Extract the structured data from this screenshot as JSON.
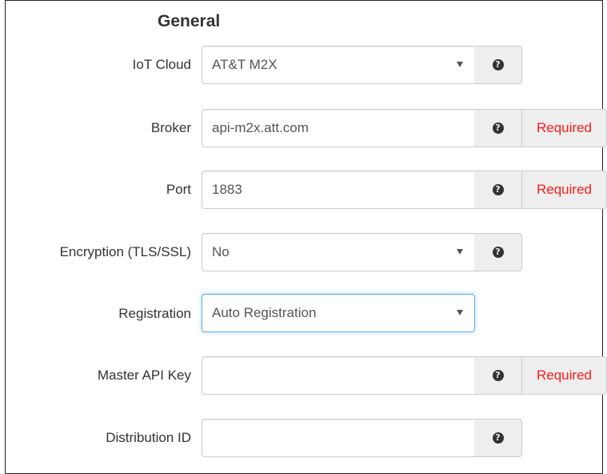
{
  "section": {
    "title": "General"
  },
  "fields": {
    "iot_cloud": {
      "label": "IoT Cloud",
      "value": "AT&T M2X"
    },
    "broker": {
      "label": "Broker",
      "value": "api-m2x.att.com",
      "status": "Required"
    },
    "port": {
      "label": "Port",
      "value": "1883",
      "status": "Required"
    },
    "encryption": {
      "label": "Encryption (TLS/SSL)",
      "value": "No"
    },
    "registration": {
      "label": "Registration",
      "value": "Auto Registration"
    },
    "master_api_key": {
      "label": "Master API Key",
      "value": "",
      "status": "Required"
    },
    "distribution_id": {
      "label": "Distribution ID",
      "value": ""
    }
  },
  "icons": {
    "help": "question-circle-icon",
    "dropdown": "caret-down-icon"
  },
  "help_glyph": "?",
  "colors": {
    "required_text": "#ff1a1a",
    "addon_bg": "#eeeeee",
    "border": "#cccccc",
    "focus": "#66afe9"
  }
}
